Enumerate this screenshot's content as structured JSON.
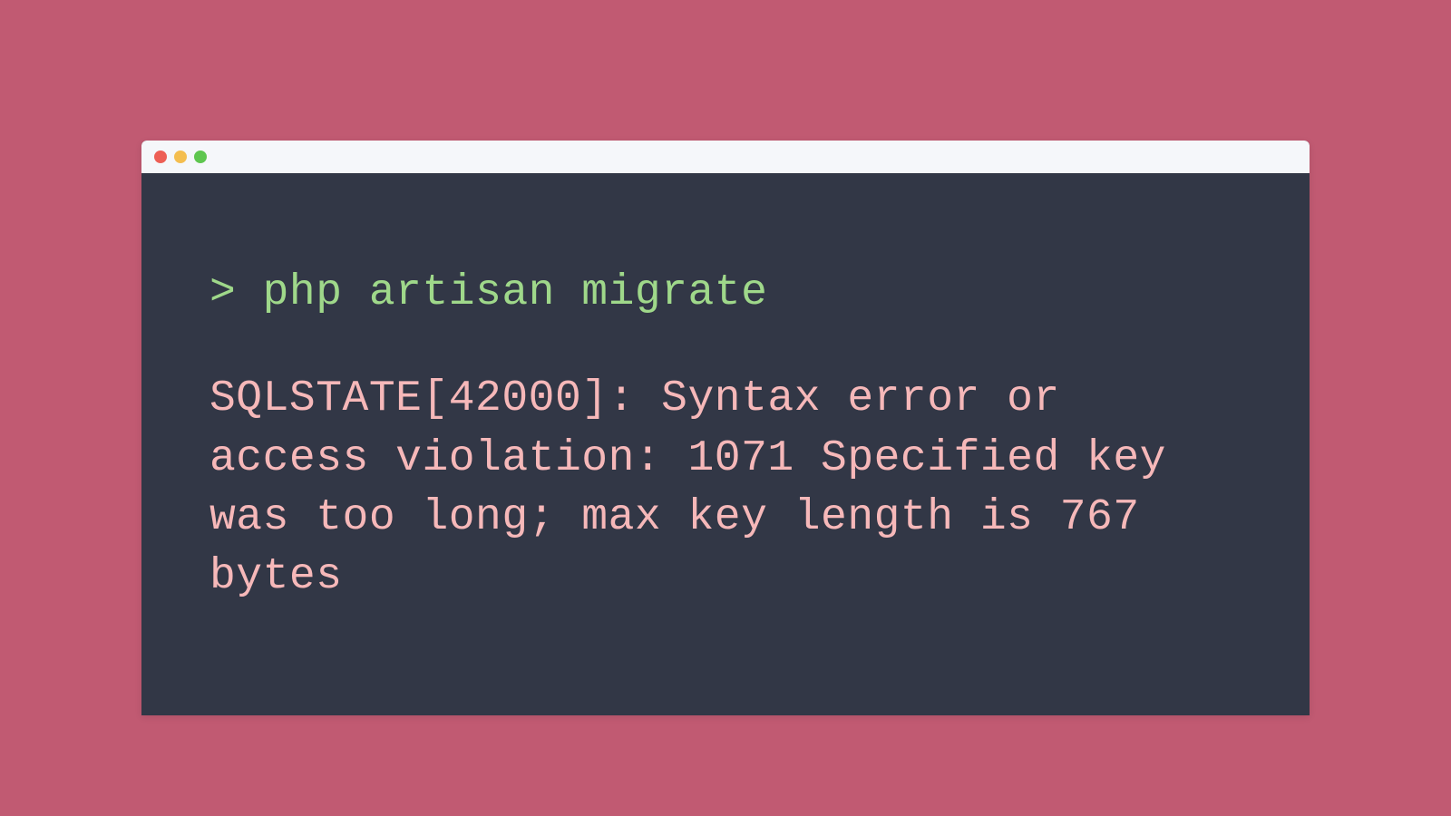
{
  "terminal": {
    "traffic_lights": {
      "red": "close",
      "yellow": "minimize",
      "green": "zoom"
    },
    "prompt_symbol": ">",
    "command": "php artisan migrate",
    "output": "SQLSTATE[42000]: Syntax error or access violation: 1071 Specified key was too long; max key length is 767 bytes"
  },
  "colors": {
    "background": "#c15a72",
    "terminal_bg": "#323746",
    "title_bar": "#f5f7fa",
    "prompt_text": "#9fd88a",
    "error_text": "#f6b8b9",
    "traffic_red": "#ed5f55",
    "traffic_yellow": "#f4be4f",
    "traffic_green": "#5ec64f"
  }
}
